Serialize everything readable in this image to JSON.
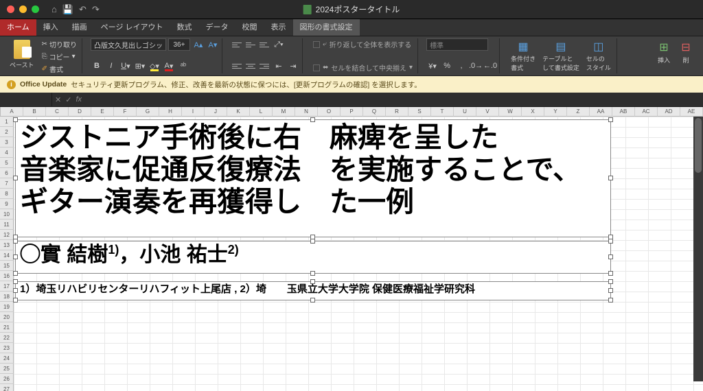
{
  "titlebar": {
    "filename": "2024ポスタータイトル"
  },
  "tabs": [
    "ホーム",
    "挿入",
    "描画",
    "ページ レイアウト",
    "数式",
    "データ",
    "校閲",
    "表示",
    "図形の書式設定"
  ],
  "ribbon": {
    "paste": "ペースト",
    "cut": "切り取り",
    "copy": "コピー",
    "format": "書式",
    "font_name": "凸版文久見出しゴシック",
    "font_size": "36+",
    "wrap": "折り返して全体を表示する",
    "merge": "セルを結合して中央揃え",
    "number_format": "標準",
    "cond_fmt": "条件付き\n書式",
    "table_fmt": "テーブルと\nして書式設定",
    "cell_style": "セルの\nスタイル",
    "insert": "挿入",
    "delete": "削"
  },
  "notice": {
    "title": "Office Update",
    "body": "セキュリティ更新プログラム、修正、改善を最新の状態に保つには、[更新プログラムの確認] を選択します。"
  },
  "fx": {
    "label": "fx"
  },
  "columns": [
    "A",
    "B",
    "C",
    "D",
    "E",
    "F",
    "G",
    "H",
    "I",
    "J",
    "K",
    "L",
    "M",
    "N",
    "O",
    "P",
    "Q",
    "R",
    "S",
    "T",
    "U",
    "V",
    "W",
    "X",
    "Y",
    "Z",
    "AA",
    "AB",
    "AC",
    "AD",
    "AE"
  ],
  "textboxes": {
    "title_l1": "ジストニア手術後に右　麻痺を呈した",
    "title_l2": "音楽家に促通反復療法　を実施することで、",
    "title_l3": "ギター演奏を再獲得し　た一例",
    "authors": "◯實 結樹1），小池 祐士2）",
    "affil": "1）埼玉リハビリセンターリハフィット上尾店 , 2）埼　　玉県立大学大学院 保健医療福祉学研究科"
  }
}
